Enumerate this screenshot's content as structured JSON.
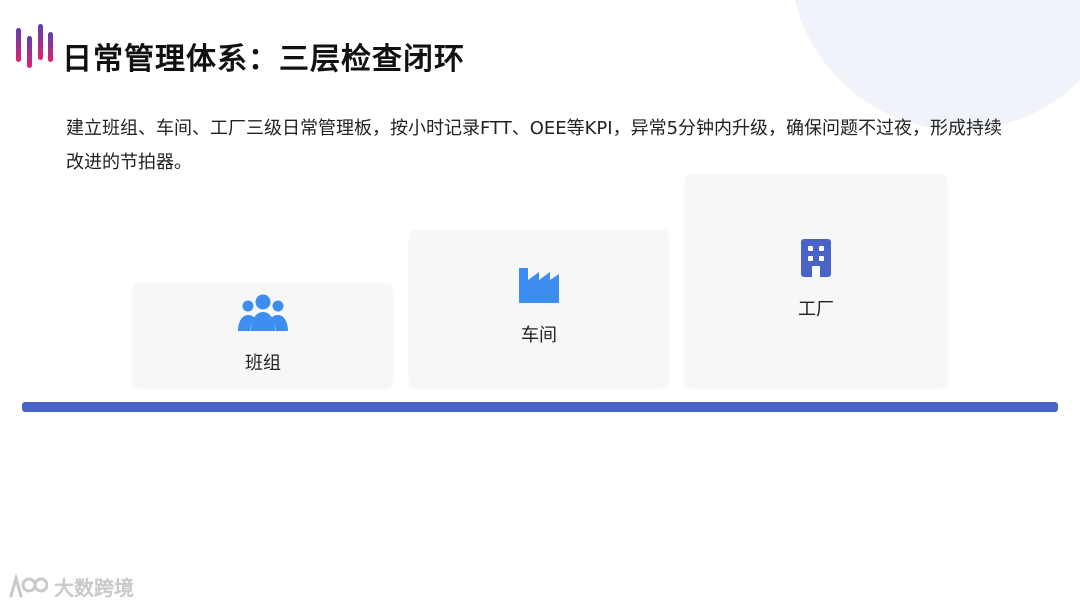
{
  "header": {
    "title": "日常管理体系：三层检查闭环"
  },
  "main": {
    "description": "建立班组、车间、工厂三级日常管理板，按小时记录FTT、OEE等KPI，异常5分钟内升级，确保问题不过夜，形成持续改进的节拍器。",
    "levels": [
      {
        "label": "班组",
        "icon": "team-icon"
      },
      {
        "label": "车间",
        "icon": "factory-icon"
      },
      {
        "label": "工厂",
        "icon": "building-icon"
      }
    ]
  },
  "watermark": {
    "text": "大数跨境"
  },
  "colors": {
    "accent_blue": "#4a63c8",
    "icon_blue": "#3d8ef0",
    "building_blue": "#4a63c8",
    "logo_pink": "#e0226e",
    "logo_purple": "#5a3fb0",
    "card_bg": "#f7f7f7"
  }
}
